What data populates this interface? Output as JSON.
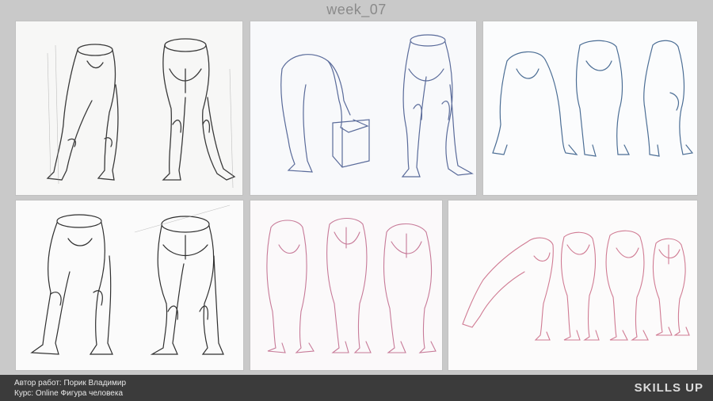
{
  "page": {
    "title": "week_07"
  },
  "panels": [
    {
      "id": "panel-1",
      "ink": "#3a3a3a",
      "medium": "pencil-graphite"
    },
    {
      "id": "panel-2",
      "ink": "#5a6b9a",
      "medium": "blue-pencil"
    },
    {
      "id": "panel-3",
      "ink": "#4c6e95",
      "medium": "blue-pencil"
    },
    {
      "id": "panel-4",
      "ink": "#2f2f2f",
      "medium": "pencil-graphite"
    },
    {
      "id": "panel-5",
      "ink": "#c77a98",
      "medium": "pink-pencil"
    },
    {
      "id": "panel-6",
      "ink": "#d07b93",
      "medium": "pink-pencil"
    }
  ],
  "footer": {
    "author": "Автор работ: Порик Владимир",
    "course": "Курс: Online Фигура человека",
    "brand": "SKILLS UP"
  }
}
